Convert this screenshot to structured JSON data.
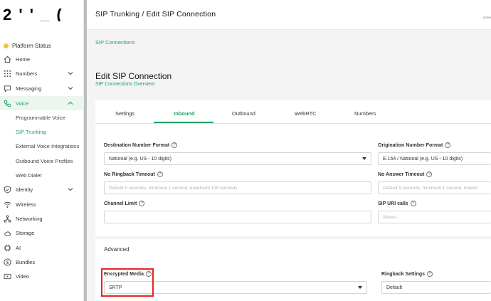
{
  "sidebar": {
    "logo": "2 ' ' _ (",
    "platform_status": "Platform Status",
    "items": [
      {
        "label": "Home",
        "icon": "home-icon"
      },
      {
        "label": "Numbers",
        "icon": "dialpad-icon"
      },
      {
        "label": "Messaging",
        "icon": "message-icon"
      },
      {
        "label": "Voice",
        "icon": "voice-icon"
      },
      {
        "label": "Identity",
        "icon": "shield-icon"
      },
      {
        "label": "Wireless",
        "icon": "wifi-icon"
      },
      {
        "label": "Networking",
        "icon": "network-icon"
      },
      {
        "label": "Storage",
        "icon": "storage-icon"
      },
      {
        "label": "AI",
        "icon": "chip-icon"
      },
      {
        "label": "Bundles",
        "icon": "dollar-icon"
      },
      {
        "label": "Video",
        "icon": "video-icon"
      }
    ],
    "voice_sub": [
      "Programmable Voice",
      "SIP Trunking",
      "External Voice Integrations",
      "Outbound Voice Profiles",
      "Web Dialer"
    ]
  },
  "header": {
    "title": "SIP Trunking / Edit SIP Connection",
    "right_text": "a free"
  },
  "breadcrumb": "SIP Connections",
  "page": {
    "title": "Edit SIP Connection",
    "subtitle": "SIP Connections Overview"
  },
  "tabs": [
    "Settings",
    "Inbound",
    "Outbound",
    "WebRTC",
    "Numbers"
  ],
  "form": {
    "dest_format_label": "Destination Number Format",
    "dest_format_value": "National (e.g. US - 10 digits)",
    "orig_format_label": "Origination Number Format",
    "orig_format_value": "E.164 / National (e.g. US - 10 digits)",
    "ringback_timeout_label": "No Ringback Timeout",
    "ringback_timeout_placeholder": "Default 5 seconds, minimum 1 second, maximum 120 seconds",
    "answer_timeout_label": "No Answer Timeout",
    "answer_timeout_placeholder": "Default 5 seconds, minimum 1 second, maxim",
    "channel_limit_label": "Channel Limit",
    "sip_uri_label": "SIP URI calls",
    "sip_uri_placeholder": "Select..."
  },
  "advanced": {
    "title": "Advanced",
    "encrypted_label": "Encrypted Media",
    "encrypted_value": "SRTP",
    "ringback_settings_label": "Ringback Settings",
    "ringback_settings_value": "Default"
  },
  "colors": {
    "accent": "#1fa463",
    "highlight": "#e32626",
    "status": "#f5c243"
  }
}
